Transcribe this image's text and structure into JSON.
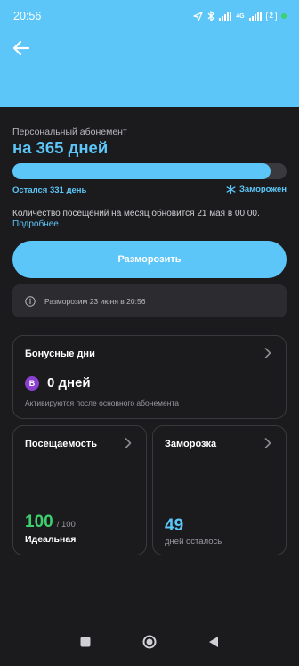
{
  "status_bar": {
    "time": "20:56",
    "battery": "2",
    "network": "4G"
  },
  "header": {
    "back_icon": "arrow-left-icon"
  },
  "subscription": {
    "subtitle": "Персональный абонемент",
    "title": "на 365 дней",
    "progress_fraction": 0.94,
    "remaining": "Остался 331 день",
    "frozen_status": "Заморожен",
    "visits_info": "Количество посещений на месяц обновится 21 мая в 00:00.",
    "more_link": "Подробнее",
    "unfreeze_button": "Разморозить",
    "notice": "Разморозим 23 июня в 20:56"
  },
  "bonus": {
    "title": "Бонусные дни",
    "badge": "B",
    "days": "0 дней",
    "note": "Активируются после основного абонемента"
  },
  "attendance": {
    "title": "Посещаемость",
    "value": "100",
    "total": "/ 100",
    "label": "Идеальная"
  },
  "freeze": {
    "title": "Заморозка",
    "value": "49",
    "label": "дней осталось"
  },
  "colors": {
    "accent": "#5cc6f8",
    "background": "#1b1b1d",
    "green": "#3ecf6e",
    "bonus_badge": "#8a3fd1"
  }
}
